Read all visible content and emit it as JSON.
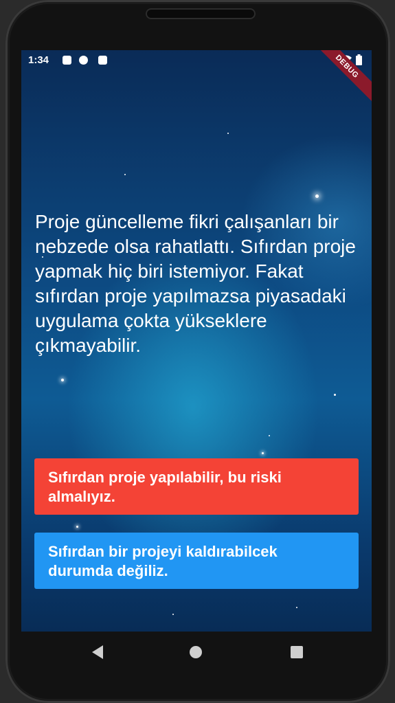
{
  "status_bar": {
    "time": "1:34",
    "debug_label": "DEBUG"
  },
  "question": {
    "text": "Proje güncelleme fikri çalışanları bir nebzede olsa rahatlattı. Sıfırdan proje yapmak hiç biri istemiyor. Fakat sıfırdan proje yapılmazsa piyasadaki uygulama çokta yükseklere çıkmayabilir."
  },
  "answers": [
    {
      "label": "Sıfırdan proje yapılabilir, bu riski almalıyız.",
      "color": "#f44336"
    },
    {
      "label": "Sıfırdan bir projeyi kaldırabilcek durumda değiliz.",
      "color": "#2196f3"
    }
  ],
  "nav_bar": {
    "icons": [
      "back-icon",
      "home-icon",
      "recent-apps-icon"
    ]
  }
}
